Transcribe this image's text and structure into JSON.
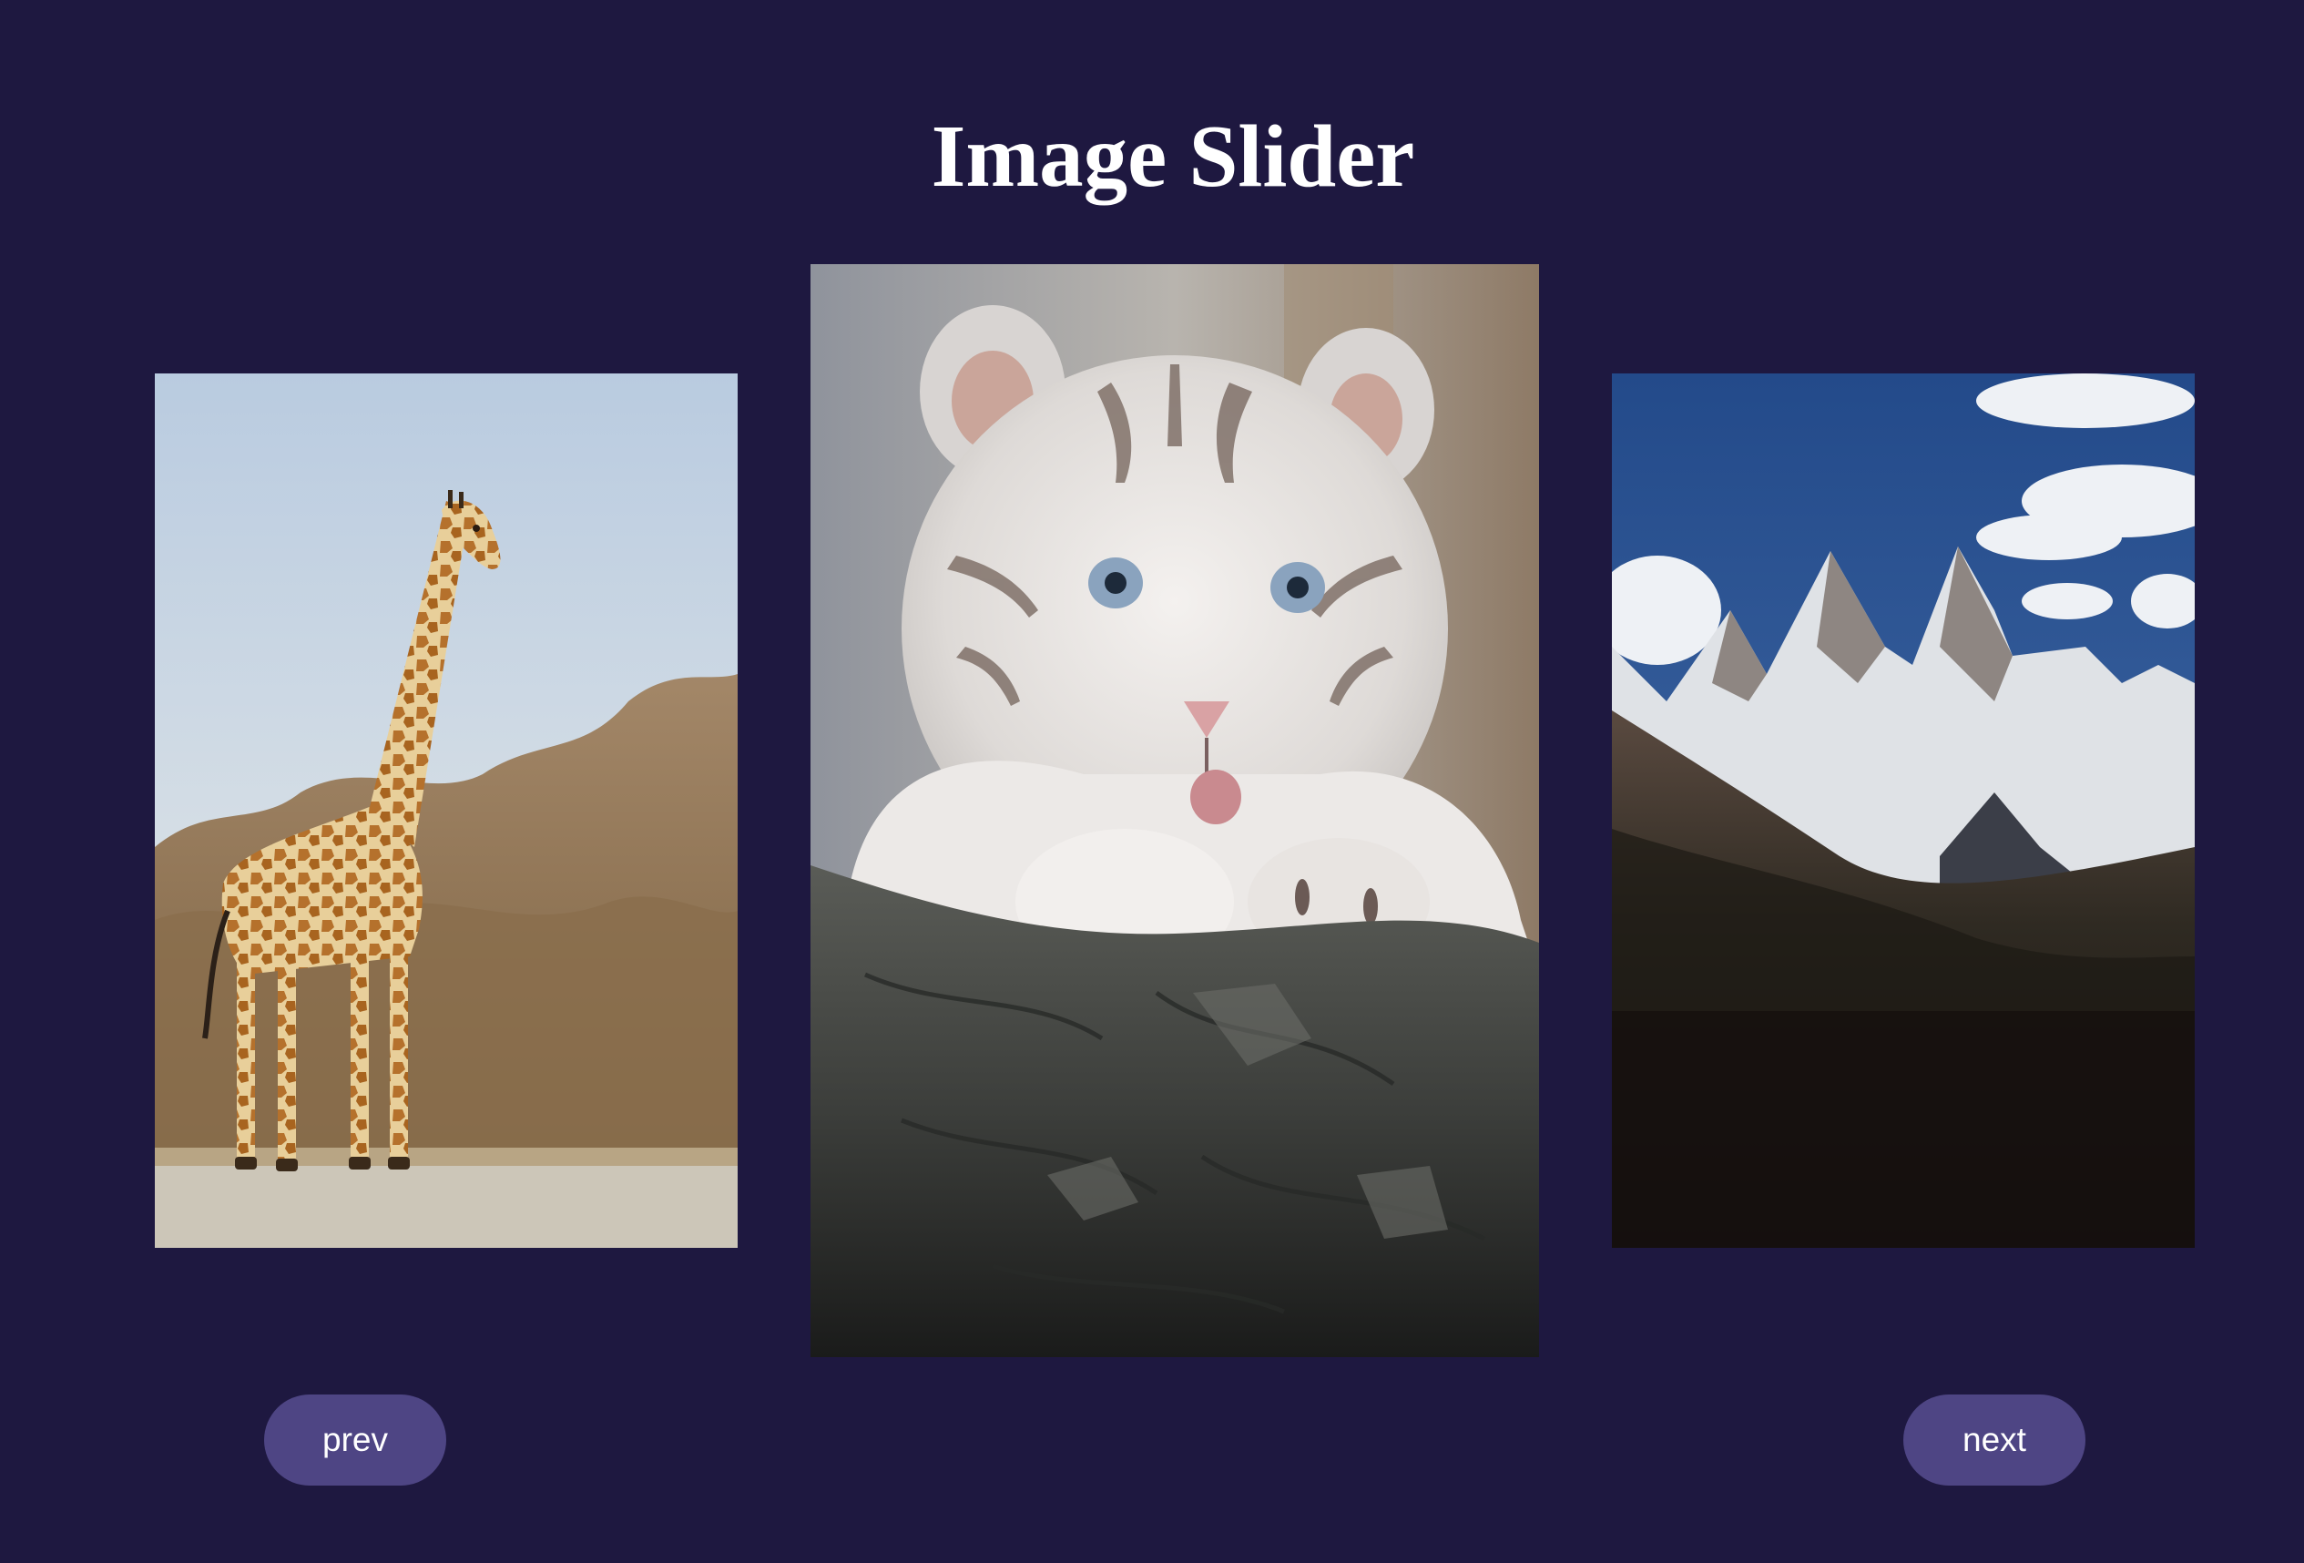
{
  "page": {
    "title": "Image Slider",
    "background_color": "#1e1840"
  },
  "slider": {
    "slides": [
      {
        "subject": "giraffe",
        "position": "left"
      },
      {
        "subject": "white tiger cub",
        "position": "center",
        "active": true
      },
      {
        "subject": "snowy mountain peaks",
        "position": "right"
      }
    ]
  },
  "controls": {
    "prev_label": "prev",
    "next_label": "next",
    "button_color": "#4e4584"
  }
}
